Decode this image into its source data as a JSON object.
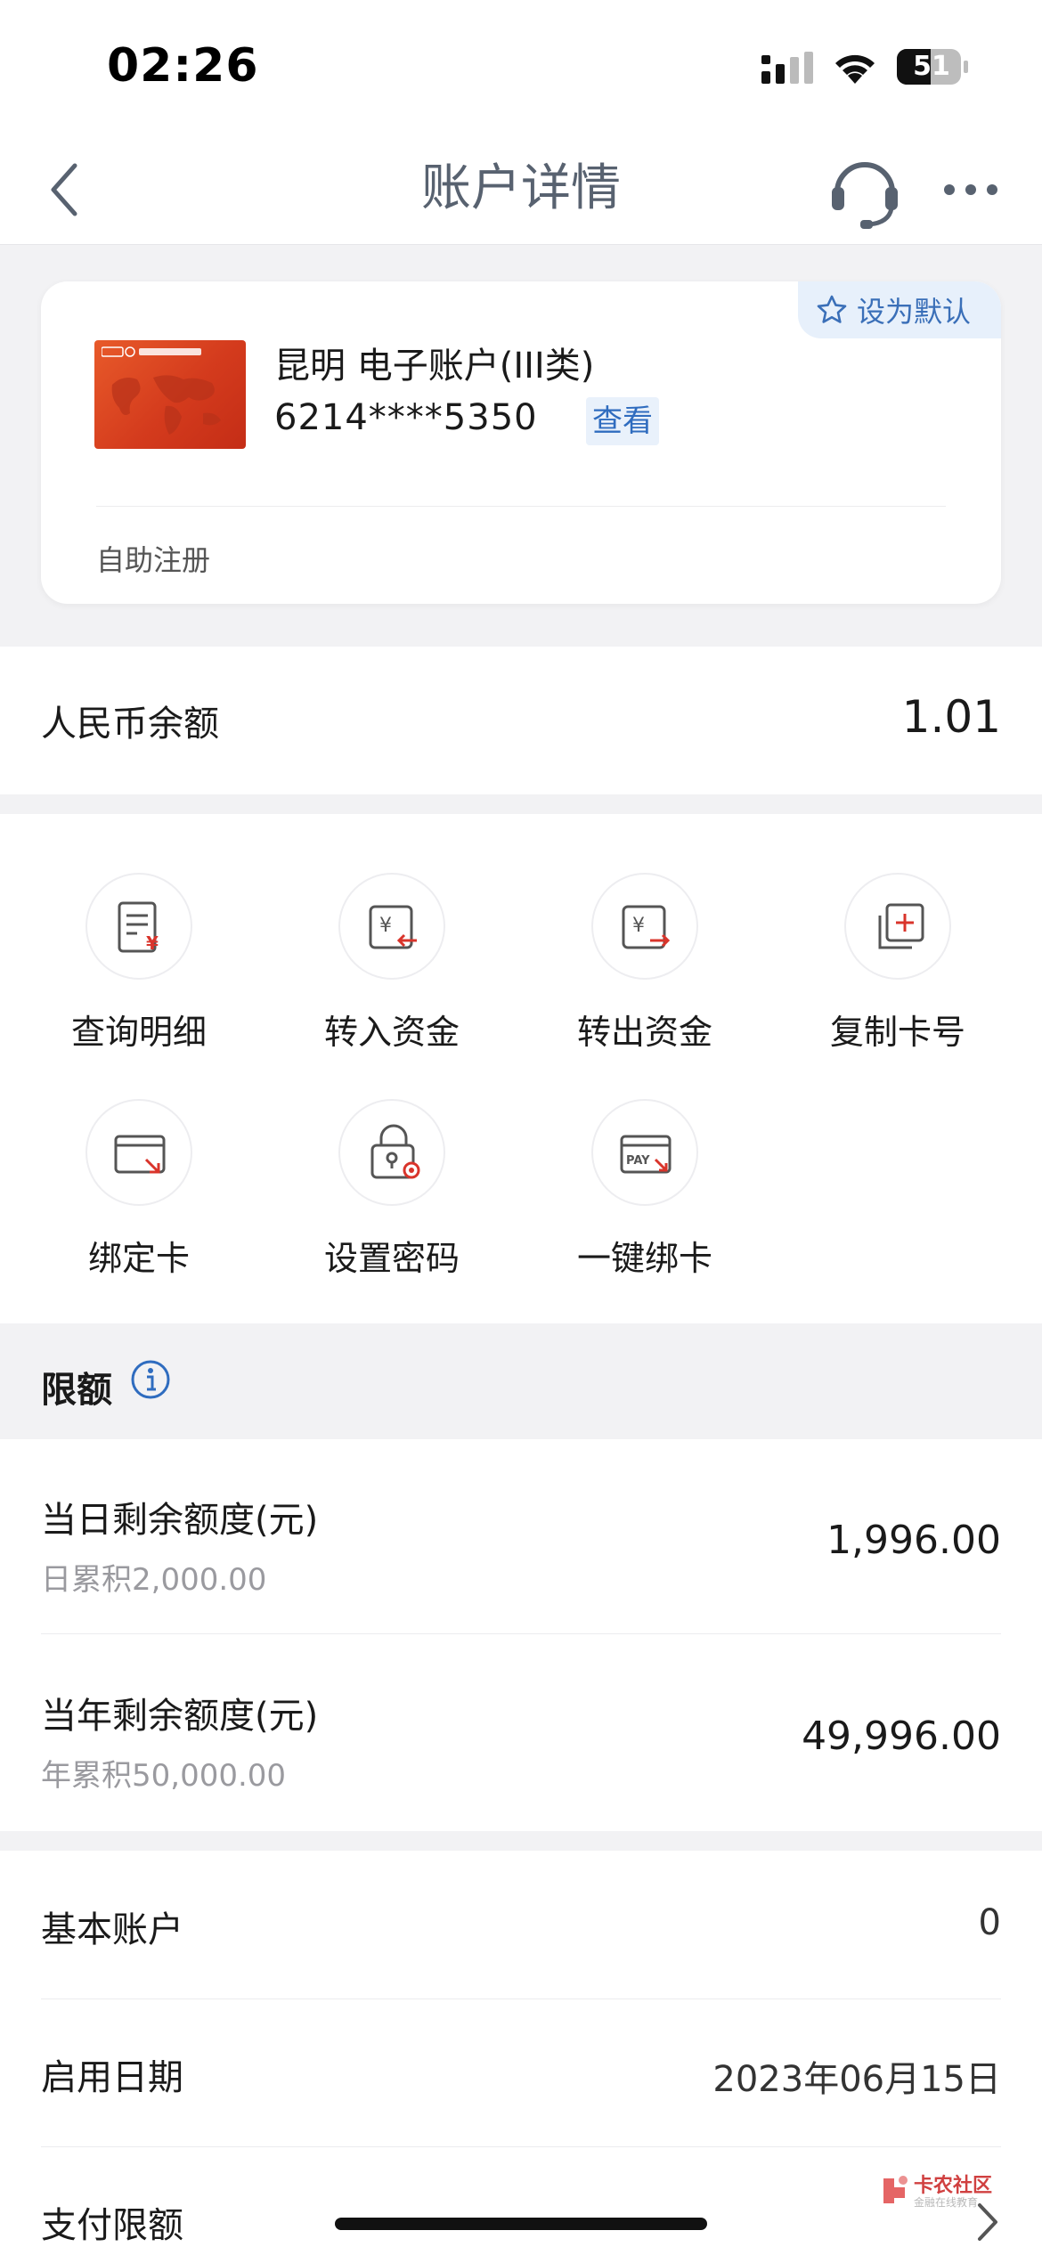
{
  "status_bar": {
    "time": "02:26",
    "battery": "51"
  },
  "nav": {
    "title": "账户详情"
  },
  "card": {
    "default_label": "设为默认",
    "account_name": "昆明 电子账户(III类)",
    "account_number": "6214****5350",
    "view_label": "查看",
    "footer": "自助注册"
  },
  "balance": {
    "label": "人民币余额",
    "value": "1.01"
  },
  "actions": [
    {
      "label": "查询明细"
    },
    {
      "label": "转入资金"
    },
    {
      "label": "转出资金"
    },
    {
      "label": "复制卡号"
    },
    {
      "label": "绑定卡"
    },
    {
      "label": "设置密码"
    },
    {
      "label": "一键绑卡"
    }
  ],
  "limits": {
    "title": "限额",
    "items": [
      {
        "title": "当日剩余额度(元)",
        "sub": "日累积2,000.00",
        "value": "1,996.00"
      },
      {
        "title": "当年剩余额度(元)",
        "sub": "年累积50,000.00",
        "value": "49,996.00"
      }
    ]
  },
  "info": [
    {
      "label": "基本账户",
      "value": "0"
    },
    {
      "label": "启用日期",
      "value": "2023年06月15日"
    },
    {
      "label": "支付限额",
      "value": ""
    }
  ],
  "watermark": {
    "title": "卡农社区",
    "subtitle": "金融在线教育"
  },
  "colors": {
    "accent": "#2f6cbf",
    "brand_red": "#d43b1d",
    "action_red": "#d9342b"
  }
}
